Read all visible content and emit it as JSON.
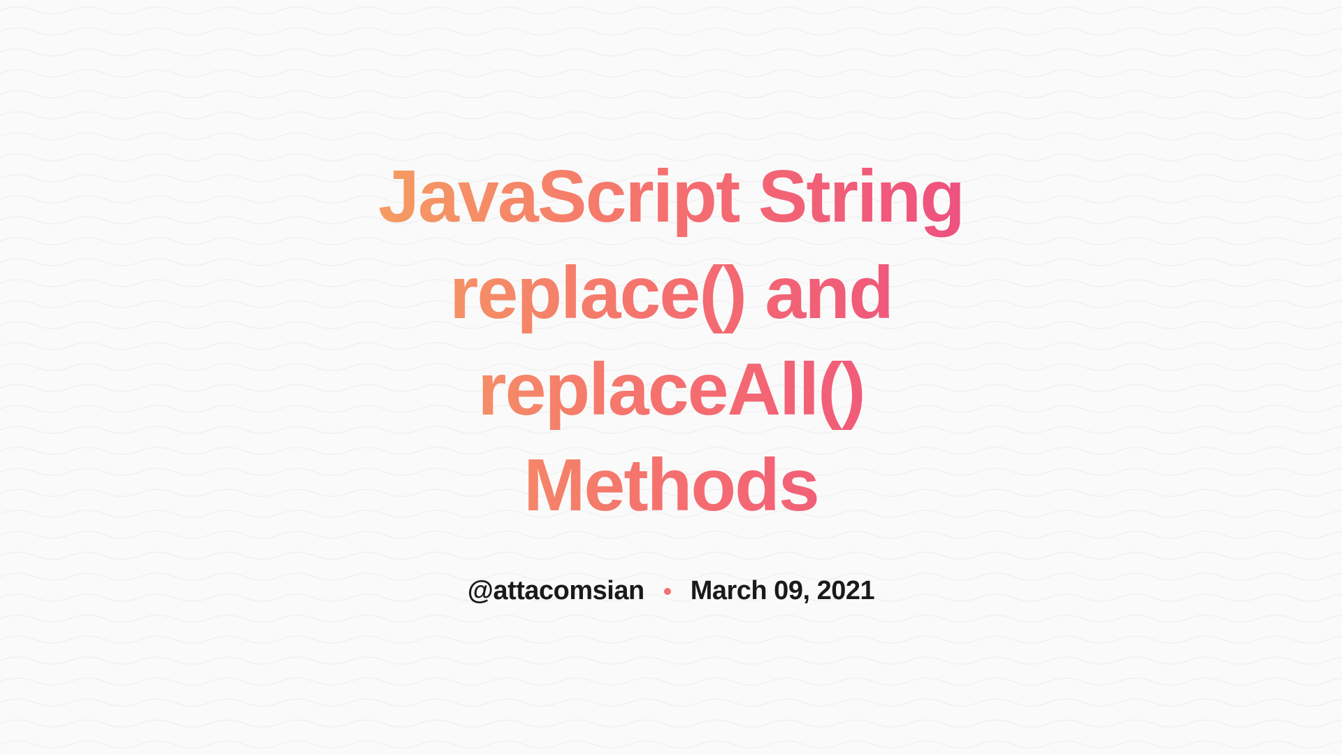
{
  "title": "JavaScript String replace() and replaceAll() Methods",
  "meta": {
    "author": "@attacomsian",
    "date": "March 09, 2021"
  },
  "colors": {
    "gradient_start": "#f5a55f",
    "gradient_mid": "#f56f6f",
    "gradient_end": "#ed4b82",
    "text": "#1a1a1a",
    "background": "#fafafa",
    "separator": "#f56f6f"
  }
}
